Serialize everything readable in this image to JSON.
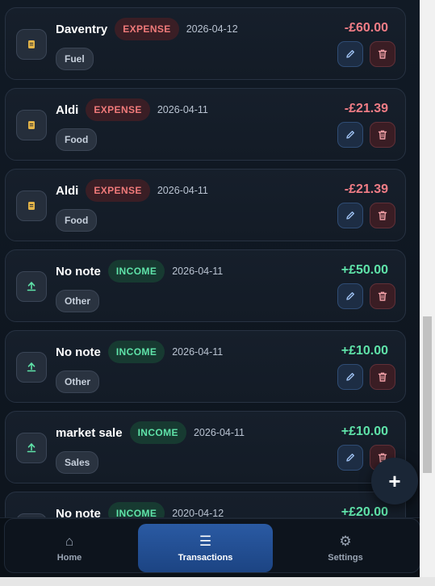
{
  "transactions": [
    {
      "title": "Daventry",
      "type": "EXPENSE",
      "date": "2026-04-12",
      "category": "Fuel",
      "amount": "-£60.00",
      "icon": "receipt-icon"
    },
    {
      "title": "Aldi",
      "type": "EXPENSE",
      "date": "2026-04-11",
      "category": "Food",
      "amount": "-£21.39",
      "icon": "receipt-icon"
    },
    {
      "title": "Aldi",
      "type": "EXPENSE",
      "date": "2026-04-11",
      "category": "Food",
      "amount": "-£21.39",
      "icon": "receipt-icon"
    },
    {
      "title": "No note",
      "type": "INCOME",
      "date": "2026-04-11",
      "category": "Other",
      "amount": "+£50.00",
      "icon": "upload-arrow-icon"
    },
    {
      "title": "No note",
      "type": "INCOME",
      "date": "2026-04-11",
      "category": "Other",
      "amount": "+£10.00",
      "icon": "upload-arrow-icon"
    },
    {
      "title": "market sale",
      "type": "INCOME",
      "date": "2026-04-11",
      "category": "Sales",
      "amount": "+£10.00",
      "icon": "upload-arrow-icon"
    },
    {
      "title": "No note",
      "type": "INCOME",
      "date": "2020-04-12",
      "category": "",
      "amount": "+£20.00",
      "icon": "upload-arrow-icon"
    }
  ],
  "fab": {
    "label": "+",
    "icon": "plus-icon"
  },
  "nav": {
    "items": [
      {
        "label": "Home",
        "icon": "home-icon",
        "glyph": "⌂",
        "active": false
      },
      {
        "label": "Transactions",
        "icon": "list-icon",
        "glyph": "☰",
        "active": true
      },
      {
        "label": "Settings",
        "icon": "gear-icon",
        "glyph": "⚙",
        "active": false
      }
    ]
  },
  "colors": {
    "expense": "#f27d86",
    "income": "#5fe3a9",
    "active_tab": "#2a5aa3"
  }
}
